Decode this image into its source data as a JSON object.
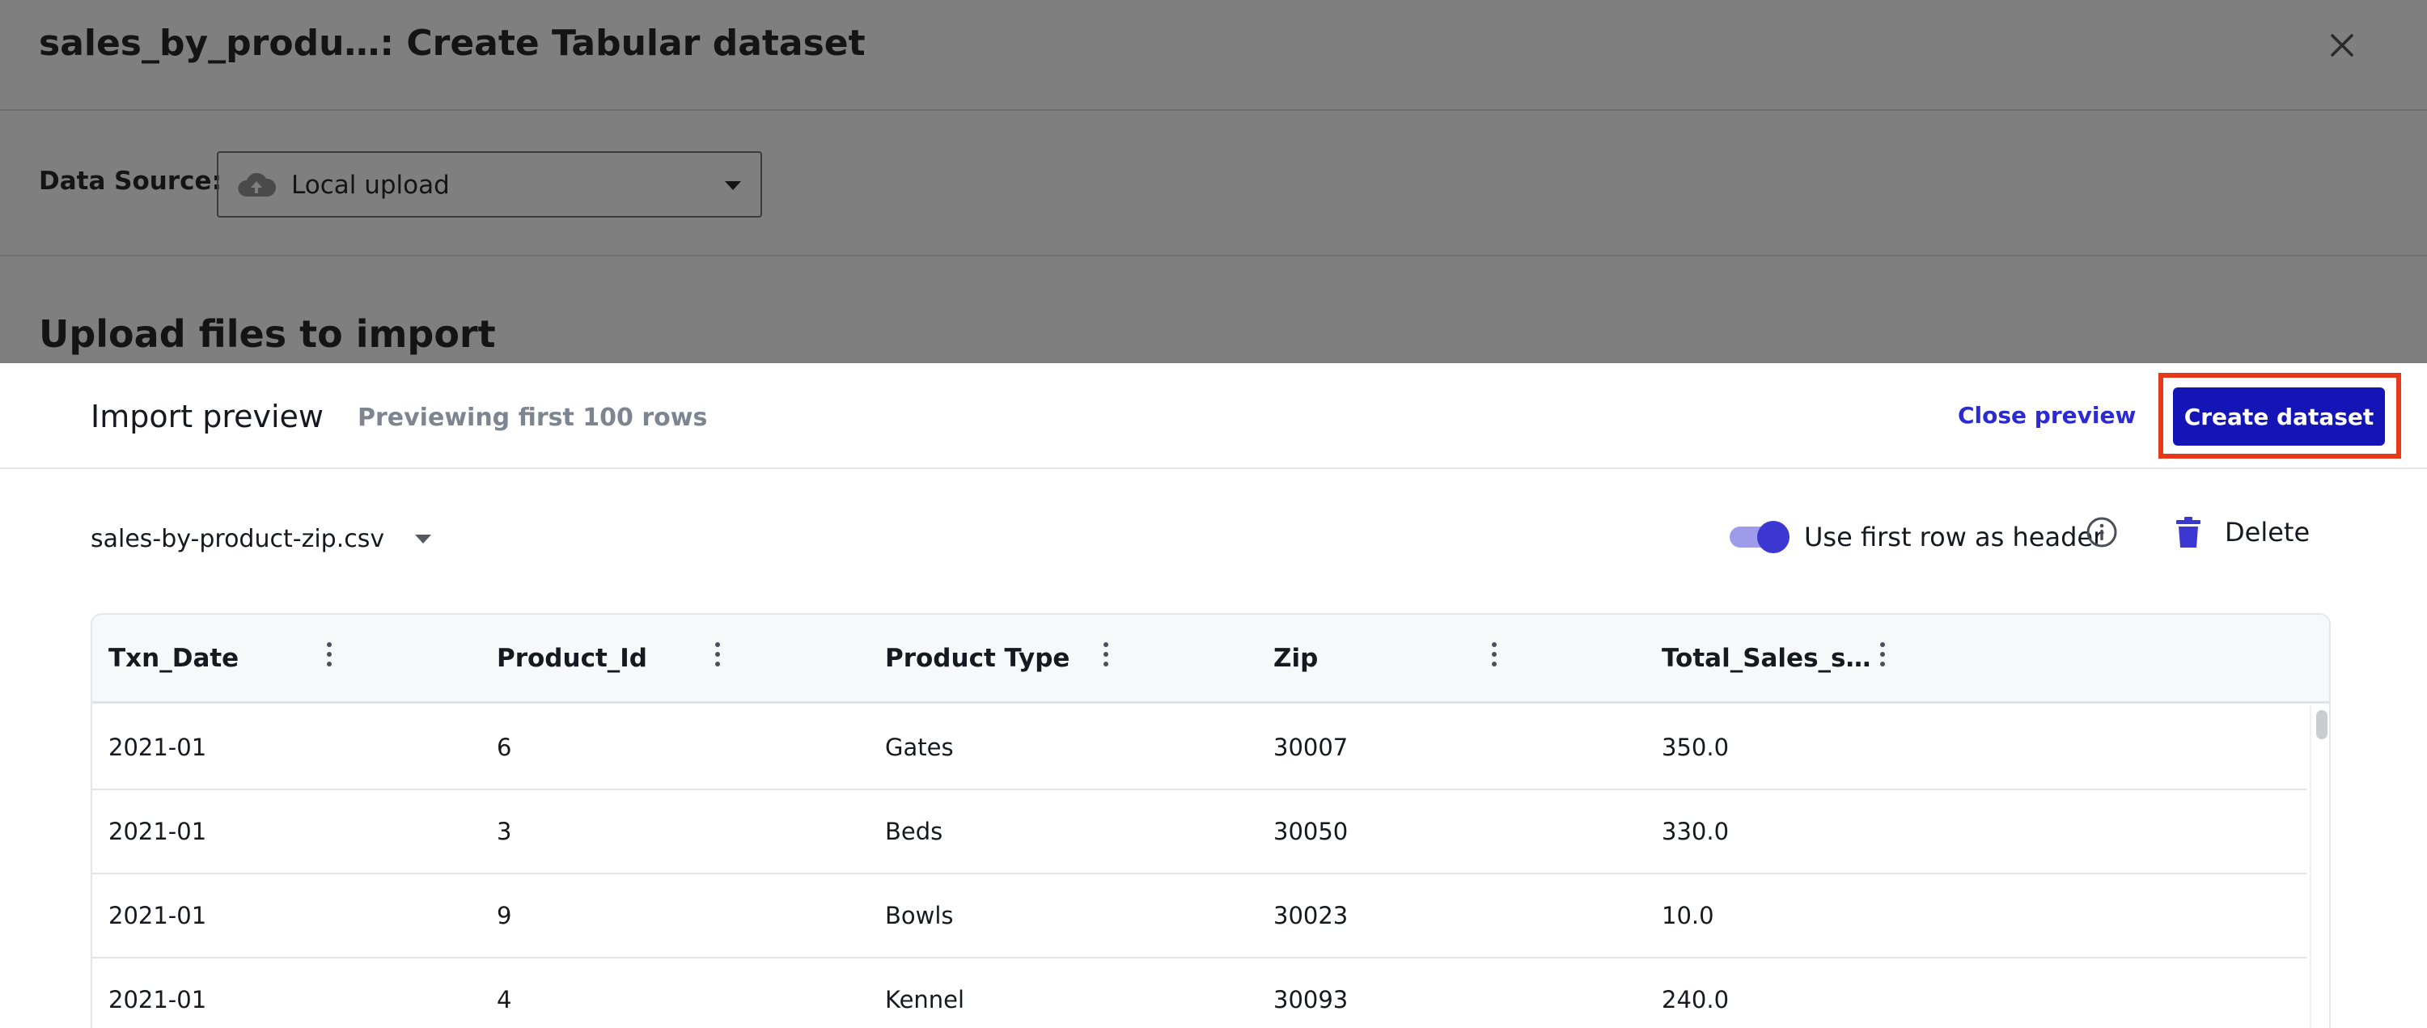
{
  "background": {
    "title": "sales_by_produ…: Create Tabular dataset",
    "data_source_label": "Data Source:",
    "data_source_value": "Local upload",
    "upload_title": "Upload files to import"
  },
  "preview": {
    "title": "Import preview",
    "subtitle": "Previewing first 100 rows",
    "close_label": "Close preview",
    "create_label": "Create dataset",
    "file_name": "sales-by-product-zip.csv",
    "header_toggle_label": "Use first row as header",
    "header_toggle_on": true,
    "delete_label": "Delete"
  },
  "table": {
    "columns": [
      "Txn_Date",
      "Product_Id",
      "Product Type",
      "Zip",
      "Total_Sales_s…"
    ],
    "rows": [
      [
        "2021-01",
        "6",
        "Gates",
        "30007",
        "350.0"
      ],
      [
        "2021-01",
        "3",
        "Beds",
        "30050",
        "330.0"
      ],
      [
        "2021-01",
        "9",
        "Bowls",
        "30023",
        "10.0"
      ],
      [
        "2021-01",
        "4",
        "Kennel",
        "30093",
        "240.0"
      ]
    ]
  },
  "colors": {
    "primary": "#1514b7",
    "link": "#2c2ad1",
    "highlight": "#e5391a",
    "toggle": "#3b37d0"
  }
}
